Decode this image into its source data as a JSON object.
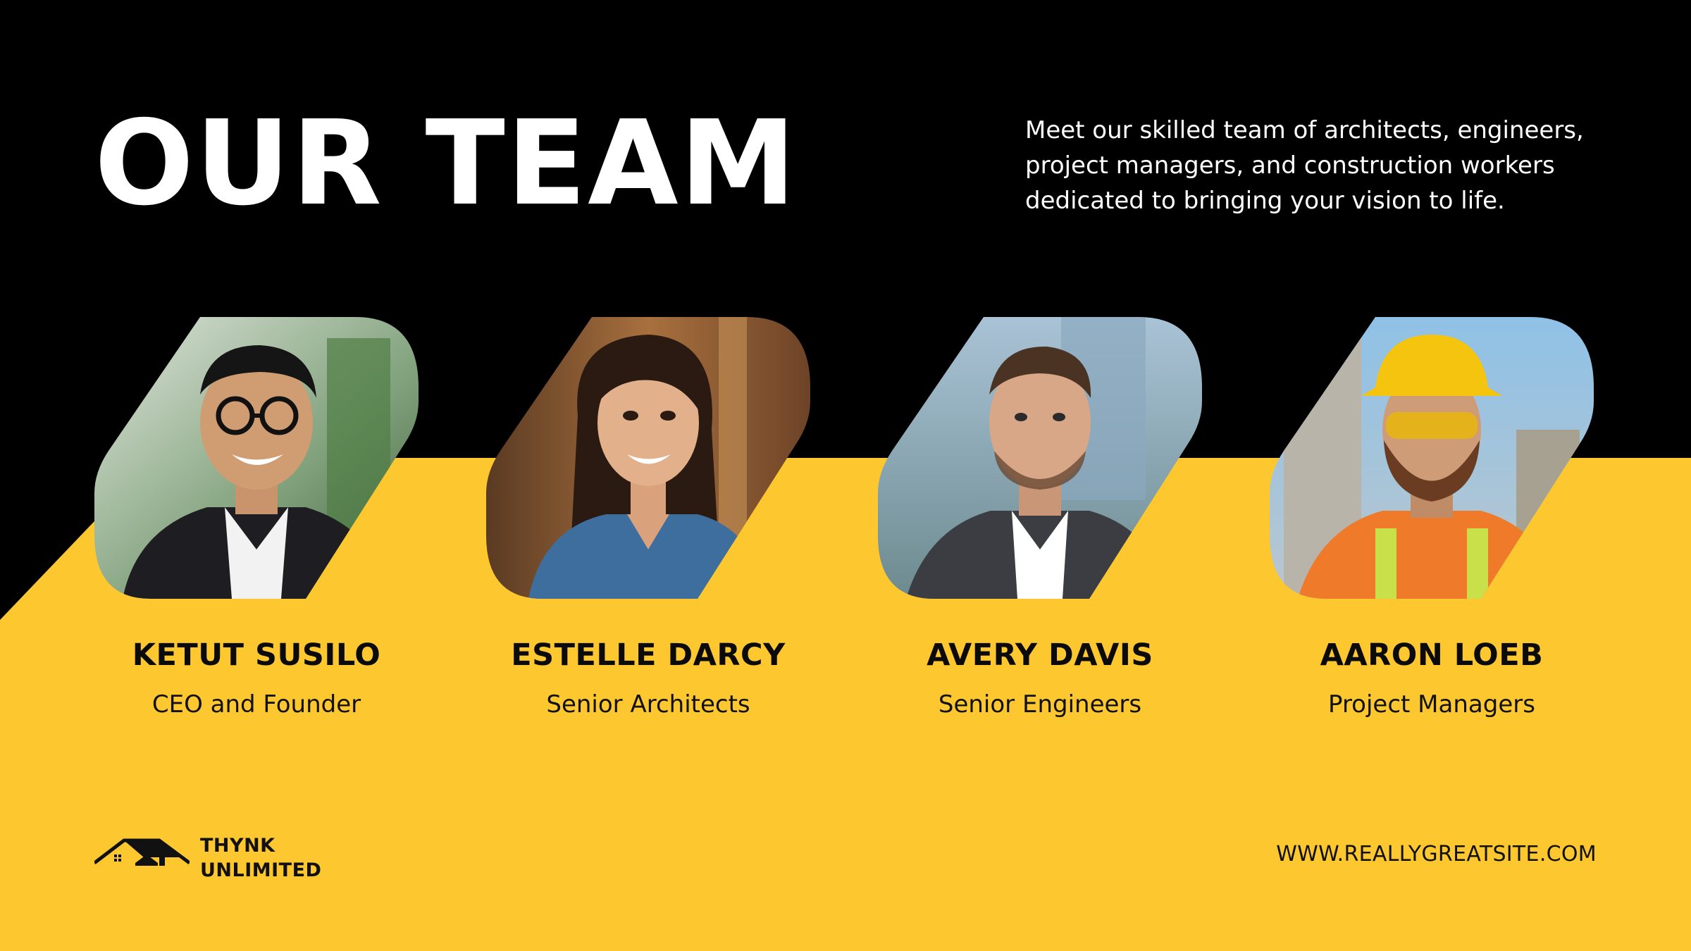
{
  "colors": {
    "black": "#000000",
    "yellow": "#fdc82f",
    "white": "#ffffff"
  },
  "heading": {
    "title": "OUR TEAM",
    "intro": "Meet our skilled team of architects, engineers, project managers, and construction workers dedicated to bringing your vision to life."
  },
  "team": [
    {
      "name": "KETUT SUSILO",
      "role": "CEO and Founder"
    },
    {
      "name": "ESTELLE DARCY",
      "role": "Senior Architects"
    },
    {
      "name": "AVERY DAVIS",
      "role": "Senior Engineers"
    },
    {
      "name": "AARON LOEB",
      "role": "Project Managers"
    }
  ],
  "footer": {
    "brand_line1": "THYNK",
    "brand_line2": "UNLIMITED",
    "website": "WWW.REALLYGREATSITE.COM",
    "logo_icon": "house-roof-icon"
  }
}
